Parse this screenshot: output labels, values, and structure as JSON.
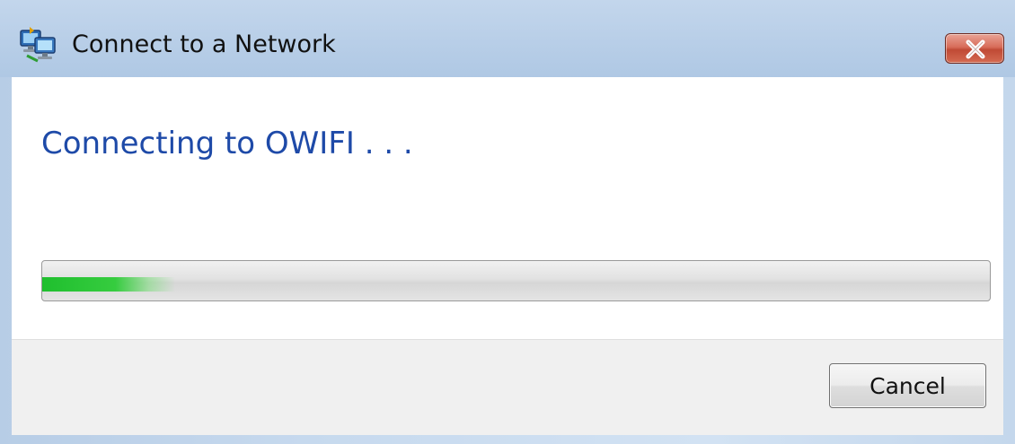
{
  "window": {
    "title": "Connect to a Network",
    "close_label": "Close"
  },
  "main": {
    "heading": "Connecting to OWIFI . . ."
  },
  "progress": {
    "fraction": 0.14,
    "style": "indeterminate-marquee",
    "fill_color": "#1fbf2e"
  },
  "footer": {
    "cancel_label": "Cancel"
  },
  "icons": {
    "title_icon": "network-connect-icon",
    "close_icon": "close-icon"
  },
  "colors": {
    "heading": "#1e4aa8",
    "close_button": "#c04a35"
  }
}
